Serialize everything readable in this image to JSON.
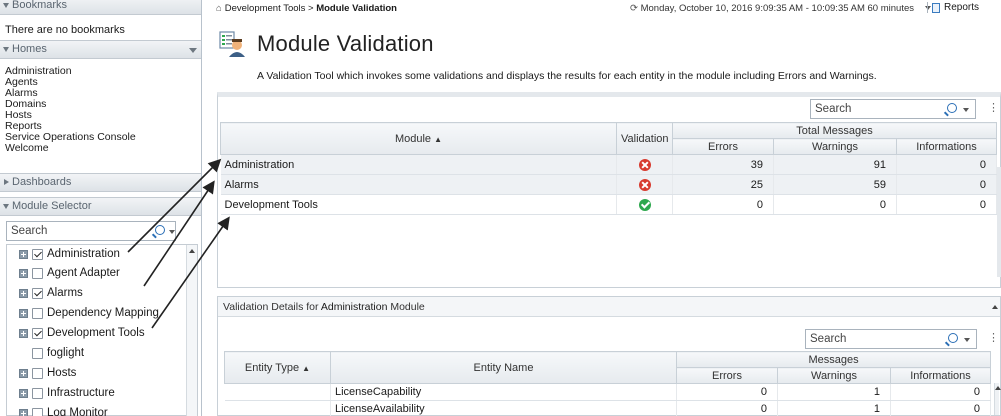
{
  "sidebar": {
    "bookmarks_header": "Bookmarks",
    "bookmarks_empty": "There are no bookmarks",
    "homes_header": "Homes",
    "homes": [
      "Administration",
      "Agents",
      "Alarms",
      "Domains",
      "Hosts",
      "Reports",
      "Service Operations Console",
      "Welcome"
    ],
    "dashboards_header": "Dashboards",
    "module_selector_header": "Module Selector",
    "search_placeholder": "Search",
    "modules": [
      {
        "label": "Administration",
        "checked": true,
        "expandable": true
      },
      {
        "label": "Agent Adapter",
        "checked": false,
        "expandable": true
      },
      {
        "label": "Alarms",
        "checked": true,
        "expandable": true
      },
      {
        "label": "Dependency Mapping",
        "checked": false,
        "expandable": true
      },
      {
        "label": "Development Tools",
        "checked": true,
        "expandable": true
      },
      {
        "label": "foglight",
        "checked": false,
        "expandable": false
      },
      {
        "label": "Hosts",
        "checked": false,
        "expandable": true
      },
      {
        "label": "Infrastructure",
        "checked": false,
        "expandable": true
      },
      {
        "label": "Log Monitor",
        "checked": false,
        "expandable": true
      }
    ]
  },
  "topbar": {
    "breadcrumb_parent": "Development Tools",
    "breadcrumb_sep": ">",
    "breadcrumb_current": "Module Validation",
    "time_range": "Monday, October 10, 2016 9:09:35 AM - 10:09:35 AM 60 minutes",
    "reports_label": "Reports"
  },
  "page": {
    "title": "Module Validation",
    "description": "A Validation Tool which invokes some validations and displays the results for each entity in the module including Errors and Warnings."
  },
  "validation_table": {
    "search_placeholder": "Search",
    "col_module": "Module",
    "col_validation": "Validation",
    "group_total": "Total Messages",
    "col_errors": "Errors",
    "col_warnings": "Warnings",
    "col_informations": "Informations",
    "rows": [
      {
        "module": "Administration",
        "status": "error",
        "errors": "39",
        "warnings": "91",
        "informations": "0"
      },
      {
        "module": "Alarms",
        "status": "error",
        "errors": "25",
        "warnings": "59",
        "informations": "0"
      },
      {
        "module": "Development Tools",
        "status": "ok",
        "errors": "0",
        "warnings": "0",
        "informations": "0"
      }
    ]
  },
  "details": {
    "header_prefix": "Validation Details for",
    "header_module": "Administration",
    "header_suffix": "Module",
    "search_placeholder": "Search",
    "col_entity_type": "Entity Type",
    "col_entity_name": "Entity Name",
    "group_messages": "Messages",
    "col_errors": "Errors",
    "col_warnings": "Warnings",
    "col_informations": "Informations",
    "rows": [
      {
        "entity_type": "",
        "entity_name": "LicenseCapability",
        "errors": "0",
        "warnings": "1",
        "informations": "0"
      },
      {
        "entity_type": "",
        "entity_name": "LicenseAvailability",
        "errors": "0",
        "warnings": "1",
        "informations": "0"
      }
    ]
  },
  "colors": {
    "error": "#d73b2f",
    "ok": "#2fa84f",
    "accent": "#2b6fb6"
  }
}
